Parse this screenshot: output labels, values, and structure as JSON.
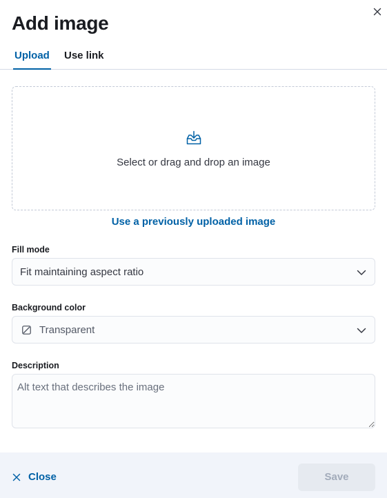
{
  "dialog": {
    "title": "Add image",
    "close_icon": "close-icon"
  },
  "tabs": [
    {
      "label": "Upload",
      "selected": true
    },
    {
      "label": "Use link",
      "selected": false
    }
  ],
  "dropzone": {
    "icon": "upload-tray-icon",
    "text": "Select or drag and drop an image"
  },
  "previous_upload_link": "Use a previously uploaded image",
  "fill_mode": {
    "label": "Fill mode",
    "value": "Fit maintaining aspect ratio"
  },
  "background_color": {
    "label": "Background color",
    "value": "Transparent",
    "swatch_icon": "transparent-swatch-icon"
  },
  "description": {
    "label": "Description",
    "placeholder": "Alt text that describes the image",
    "value": ""
  },
  "footer": {
    "close_label": "Close",
    "save_label": "Save",
    "save_enabled": false
  },
  "colors": {
    "accent": "#0061a6",
    "footer_bg": "#f1f4fa",
    "disabled_bg": "#e6eaf0",
    "disabled_text": "#a2abba"
  }
}
